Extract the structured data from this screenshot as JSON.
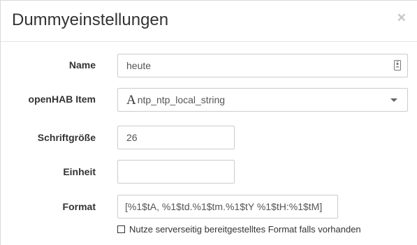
{
  "dialog": {
    "title": "Dummyeinstellungen",
    "close_symbol": "×"
  },
  "form": {
    "name": {
      "label": "Name",
      "value": "heute",
      "icon": "contact-card-icon"
    },
    "item": {
      "label": "openHAB Item",
      "type_icon": "A",
      "value": "ntp_ntp_local_string"
    },
    "font_size": {
      "label": "Schriftgröße",
      "value": "26"
    },
    "unit": {
      "label": "Einheit",
      "value": ""
    },
    "format": {
      "label": "Format",
      "value": "[%1$tA, %1$td.%1$tm.%1$tY %1$tH:%1$tM]"
    },
    "server_format_checkbox": {
      "label": "Nutze serverseitig bereitgestelltes Format falls vorhanden",
      "checked": false
    }
  }
}
